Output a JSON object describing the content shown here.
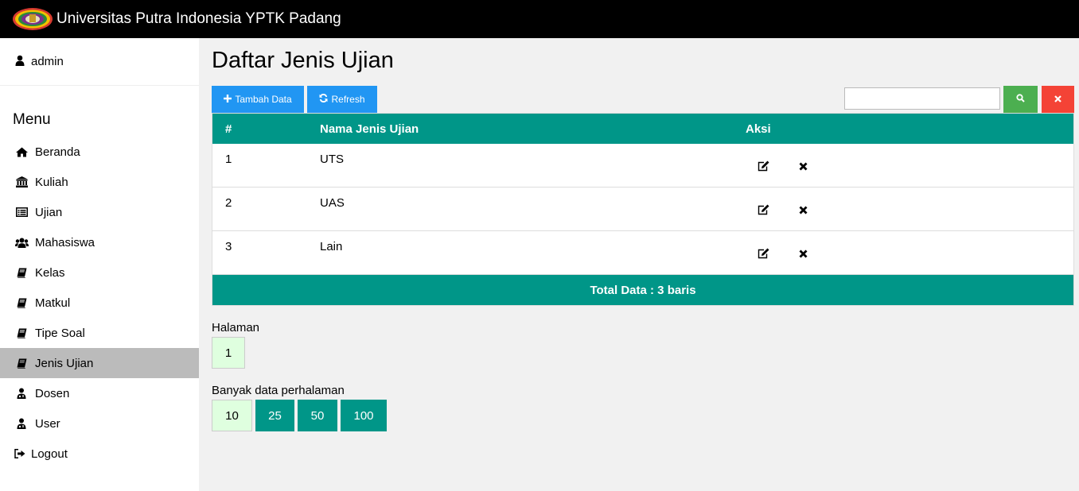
{
  "header": {
    "title": "Universitas Putra Indonesia YPTK Padang",
    "logo_icon": "university-logo-icon"
  },
  "user": {
    "name": "admin",
    "icon": "user-icon"
  },
  "menu": {
    "title": "Menu",
    "items": [
      {
        "label": "Beranda",
        "icon": "home-icon"
      },
      {
        "label": "Kuliah",
        "icon": "institution-icon"
      },
      {
        "label": "Ujian",
        "icon": "list-alt-icon"
      },
      {
        "label": "Mahasiswa",
        "icon": "users-icon"
      },
      {
        "label": "Kelas",
        "icon": "book-icon"
      },
      {
        "label": "Matkul",
        "icon": "book-icon"
      },
      {
        "label": "Tipe Soal",
        "icon": "book-icon"
      },
      {
        "label": "Jenis Ujian",
        "icon": "book-icon",
        "active": true
      },
      {
        "label": "Dosen",
        "icon": "user-md-icon"
      },
      {
        "label": "User",
        "icon": "user-md-icon"
      }
    ],
    "logout": "Logout"
  },
  "page": {
    "title": "Daftar Jenis Ujian",
    "add_label": "Tambah Data",
    "refresh_label": "Refresh",
    "search_value": "",
    "colors": {
      "primary": "#2196f3",
      "success": "#4caf50",
      "danger": "#f44336",
      "teal": "#009688"
    }
  },
  "table": {
    "headers": {
      "num": "#",
      "name": "Nama Jenis Ujian",
      "aksi": "Aksi"
    },
    "rows": [
      {
        "num": "1",
        "name": "UTS"
      },
      {
        "num": "2",
        "name": "UAS"
      },
      {
        "num": "3",
        "name": "Lain"
      }
    ],
    "footer": "Total Data : 3 baris"
  },
  "pagination": {
    "label": "Halaman",
    "pages": [
      "1"
    ],
    "per_page_label": "Banyak data perhalaman",
    "per_page_options": [
      "10",
      "25",
      "50",
      "100"
    ],
    "per_page_selected": "10"
  }
}
